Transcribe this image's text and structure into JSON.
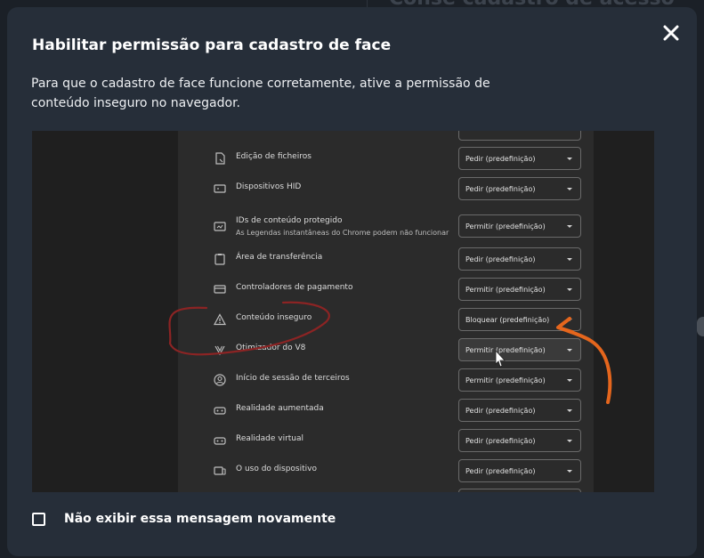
{
  "backdrop": {
    "title": "Consé cadastro de acesso"
  },
  "modal": {
    "title": "Habilitar permissão para cadastro de face",
    "description": "Para que o cadastro de face funcione corretamente, ative a permissão de conteúdo inseguro no navegador.",
    "close_icon": "close-icon",
    "checkbox_label": "Não exibir essa mensagem novamente",
    "checkbox_checked": false
  },
  "screenshot": {
    "rows": [
      {
        "label": "Edição de ficheiros",
        "icon": "file-edit-icon",
        "value": "Pedir (predefinição)"
      },
      {
        "label": "Dispositivos HID",
        "icon": "hid-device-icon",
        "value": "Pedir (predefinição)"
      },
      {
        "label": "IDs de conteúdo protegido",
        "sublabel": "As Legendas instantâneas do Chrome podem não funcionar",
        "icon": "protected-content-icon",
        "value": "Permitir (predefinição)"
      },
      {
        "label": "Área de transferência",
        "icon": "clipboard-icon",
        "value": "Pedir (predefinição)"
      },
      {
        "label": "Controladores de pagamento",
        "icon": "payment-card-icon",
        "value": "Permitir (predefinição)"
      },
      {
        "label": "Conteúdo inseguro",
        "icon": "warning-icon",
        "value": "Bloquear (predefinição)"
      },
      {
        "label": "Otimizador do V8",
        "icon": "v8-optimizer-icon",
        "value": "Permitir (predefinição)"
      },
      {
        "label": "Início de sessão de terceiros",
        "icon": "account-icon",
        "value": "Permitir (predefinição)"
      },
      {
        "label": "Realidade aumentada",
        "icon": "augmented-reality-icon",
        "value": "Pedir (predefinição)"
      },
      {
        "label": "Realidade virtual",
        "icon": "virtual-reality-icon",
        "value": "Pedir (predefinição)"
      },
      {
        "label": "O uso do dispositivo",
        "icon": "device-use-icon",
        "value": "Pedir (predefinição)"
      }
    ],
    "annotation_color": "#e5661d",
    "circle_color": "#8c2424"
  },
  "colors": {
    "modal_bg": "#262e39",
    "page_bg": "#1b2027"
  }
}
